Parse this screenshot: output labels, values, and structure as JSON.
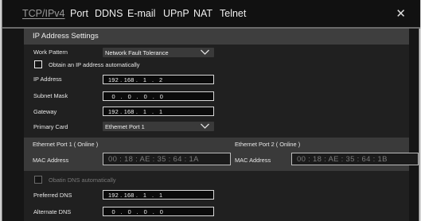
{
  "tabs": [
    {
      "label": "TCP/IPv4",
      "active": true
    },
    {
      "label": "Port"
    },
    {
      "label": "DDNS"
    },
    {
      "label": "E-mail"
    },
    {
      "label": "UPnP"
    },
    {
      "label": "NAT"
    },
    {
      "label": "Telnet"
    }
  ],
  "close_glyph": "✕",
  "section_title": "IP Address Settings",
  "work_pattern": {
    "label": "Work Pattern",
    "value": "Network Fault Tolerance"
  },
  "obtain_ip": {
    "label": "Obtain an IP address automatically",
    "checked": false
  },
  "ip_address": {
    "label": "IP Address",
    "value": "192 . 168 .   1   .   2"
  },
  "subnet_mask": {
    "label": "Subnet Mask",
    "value": "  0   .   0   .   0   .   0"
  },
  "gateway": {
    "label": "Gateway",
    "value": "192 . 168 .   1   .   1"
  },
  "primary_card": {
    "label": "Primary Card",
    "value": "Ethernet Port 1"
  },
  "ports": [
    {
      "title": "Ethernet Port 1 ( Online )",
      "mac_label": "MAC Address",
      "mac": "00 : 18 : AE : 35 : 64 : 1A"
    },
    {
      "title": "Ethernet Port 2 ( Online )",
      "mac_label": "MAC Address",
      "mac": "00 : 18 : AE : 35 : 64 : 1B"
    }
  ],
  "obtain_dns": {
    "label": "Obatin DNS automatically",
    "checked": false,
    "disabled": true
  },
  "preferred_dns": {
    "label": "Preferred DNS",
    "value": "192 . 168 .   1   .   1"
  },
  "alternate_dns": {
    "label": "Alternate DNS",
    "value": "  0   .   0   .   0   .   0"
  },
  "icons": {
    "close": "close-icon",
    "chevron": "chevron-down-icon",
    "checkbox": "checkbox-icon"
  }
}
